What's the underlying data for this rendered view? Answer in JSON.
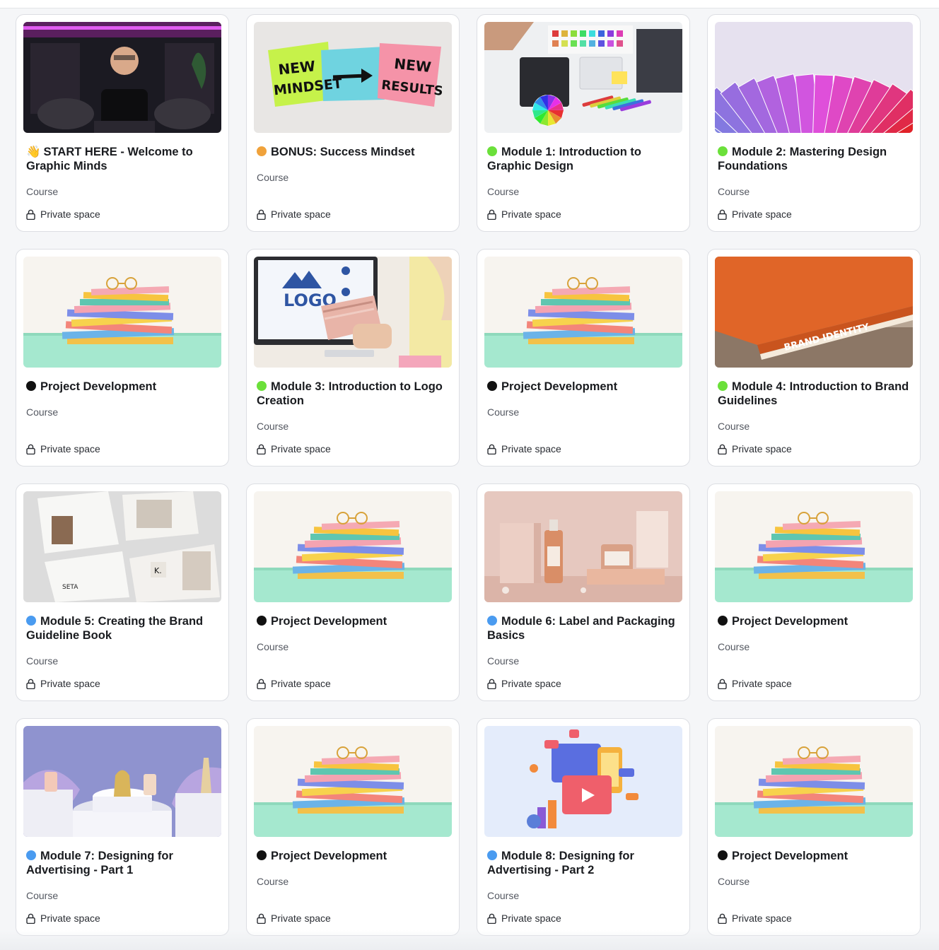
{
  "colors": {
    "green": "#6be03a",
    "orange": "#f0a23b",
    "blue": "#4a9bf0",
    "black": "#111111"
  },
  "cards": [
    {
      "title": "START HERE - Welcome to Graphic Minds",
      "emoji": "👋",
      "dot": null,
      "type": "Course",
      "access": "Private space",
      "thumb": "video-studio"
    },
    {
      "title": "BONUS: Success Mindset",
      "emoji": null,
      "dot": "orange",
      "type": "Course",
      "access": "Private space",
      "thumb": "sticky-notes"
    },
    {
      "title": "Module 1: Introduction to Graphic Design",
      "emoji": null,
      "dot": "green",
      "type": "Course",
      "access": "Private space",
      "thumb": "designer-desk"
    },
    {
      "title": "Module 2: Mastering Design Foundations",
      "emoji": null,
      "dot": "green",
      "type": "Course",
      "access": "Private space",
      "thumb": "color-swatches"
    },
    {
      "title": "Project Development",
      "emoji": null,
      "dot": "black",
      "type": "Course",
      "access": "Private space",
      "thumb": "book-stack"
    },
    {
      "title": "Module 3: Introduction to Logo Creation",
      "emoji": null,
      "dot": "green",
      "type": "Course",
      "access": "Private space",
      "thumb": "logo-screen",
      "thumb_text": "LOGO"
    },
    {
      "title": "Project Development",
      "emoji": null,
      "dot": "black",
      "type": "Course",
      "access": "Private space",
      "thumb": "book-stack"
    },
    {
      "title": "Module 4: Introduction to Brand Guidelines",
      "emoji": null,
      "dot": "green",
      "type": "Course",
      "access": "Private space",
      "thumb": "brand-book",
      "thumb_text": "BRAND IDENTITY"
    },
    {
      "title": "Module 5: Creating the Brand Guideline Book",
      "emoji": null,
      "dot": "blue",
      "type": "Course",
      "access": "Private space",
      "thumb": "brochure"
    },
    {
      "title": "Project Development",
      "emoji": null,
      "dot": "black",
      "type": "Course",
      "access": "Private space",
      "thumb": "book-stack"
    },
    {
      "title": "Module 6: Label and Packaging Basics",
      "emoji": null,
      "dot": "blue",
      "type": "Course",
      "access": "Private space",
      "thumb": "packaging"
    },
    {
      "title": "Project Development",
      "emoji": null,
      "dot": "black",
      "type": "Course",
      "access": "Private space",
      "thumb": "book-stack"
    },
    {
      "title": "Module 7: Designing for Advertising - Part 1",
      "emoji": null,
      "dot": "blue",
      "type": "Course",
      "access": "Private space",
      "thumb": "perfume"
    },
    {
      "title": "Project Development",
      "emoji": null,
      "dot": "black",
      "type": "Course",
      "access": "Private space",
      "thumb": "book-stack"
    },
    {
      "title": "Module 8: Designing for Advertising - Part 2",
      "emoji": null,
      "dot": "blue",
      "type": "Course",
      "access": "Private space",
      "thumb": "social-media"
    },
    {
      "title": "Project Development",
      "emoji": null,
      "dot": "black",
      "type": "Course",
      "access": "Private space",
      "thumb": "book-stack"
    }
  ]
}
